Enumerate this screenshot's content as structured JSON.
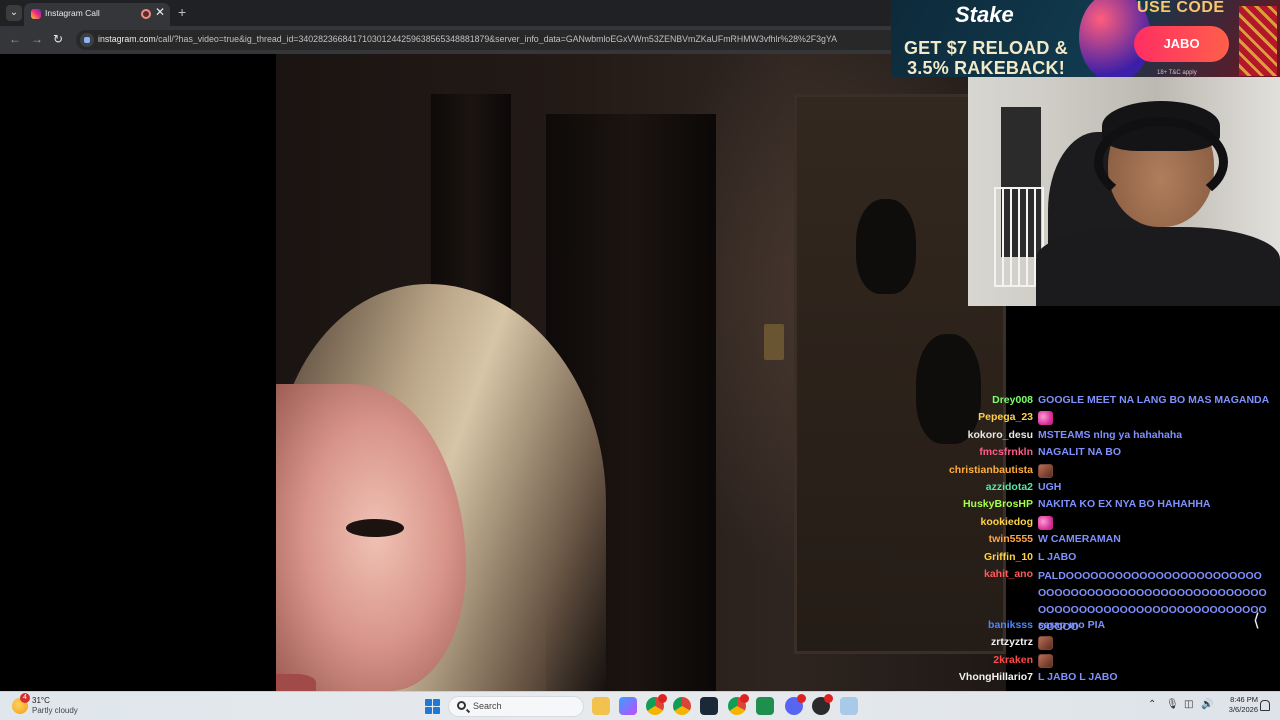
{
  "browser": {
    "tab_title": "Instagram Call",
    "url_host": "instagram.com",
    "url_path": "/call/?has_video=true&ig_thread_id=340282366841710301244259638565348881879&server_info_data=GANwbmloEGxVWm53ZENBVmZKaUFmRHMW3vfhlr%28%2F3gYA",
    "new_tab_symbol": "+",
    "close_symbol": "✕"
  },
  "banner": {
    "logo": "Stake",
    "headline_line1": "GET $7 RELOAD &",
    "headline_line2": "3.5% RAKEBACK!",
    "use_code": "USE CODE",
    "code": "JABO",
    "fine_print": "18+ T&C apply"
  },
  "chat": {
    "messages": [
      {
        "user": "Drey008",
        "color": "#7cff6b",
        "text": "GOOGLE MEET NA LANG BO MAS MAGANDA"
      },
      {
        "user": "Pepega_23",
        "color": "#ffd24a",
        "text": "",
        "emote": "heart"
      },
      {
        "user": "kokoro_desu",
        "color": "#e8e8e8",
        "text": "MSTEAMS nlng ya hahahaha"
      },
      {
        "user": "fmcsfrnkln",
        "color": "#ff5c8a",
        "text": "NAGALIT NA BO"
      },
      {
        "user": "christianbautista",
        "color": "#ffae3d",
        "text": "",
        "emote": "photo"
      },
      {
        "user": "azzidota2",
        "color": "#59e6a5",
        "text": "UGH"
      },
      {
        "user": "HuskyBrosHP",
        "color": "#a6ff4a",
        "text": "NAKITA KO EX NYA BO HAHAHHA"
      },
      {
        "user": "kookiedog",
        "color": "#ffd24a",
        "text": "",
        "emote": "heart"
      },
      {
        "user": "twin5555",
        "color": "#ffa64a",
        "text": "W CAMERAMAN"
      },
      {
        "user": "Griffin_10",
        "color": "#ffd24a",
        "text": "L JABO"
      },
      {
        "user": "kahit_ano",
        "color": "#ff5a5a",
        "text": "PALDOOOOOOOOOOOOOOOOOOOOOOOOOOOOOOOOOOOOOOOOOOOOOOOOOOOOOOOOOOOOOOOOOOOOOOOOOOOOOOOOOOOOO",
        "wrap": true
      },
      {
        "user": "baniksss",
        "color": "#4a86ff",
        "text": "sarap mo PIA"
      },
      {
        "user": "zrtzyztrz",
        "color": "#f2f2f2",
        "text": "",
        "emote": "photo"
      },
      {
        "user": "2kraken",
        "color": "#ff4a4a",
        "text": "",
        "emote": "photo"
      },
      {
        "user": "VhongHillario7",
        "color": "#f2f2f2",
        "text": "L JABO L JABO"
      }
    ]
  },
  "taskbar": {
    "weather_temp": "31°C",
    "weather_desc": "Partly cloudy",
    "weather_badge": "4",
    "search_label": "Search",
    "time": "8:46 PM",
    "date": "3/6/2026"
  }
}
